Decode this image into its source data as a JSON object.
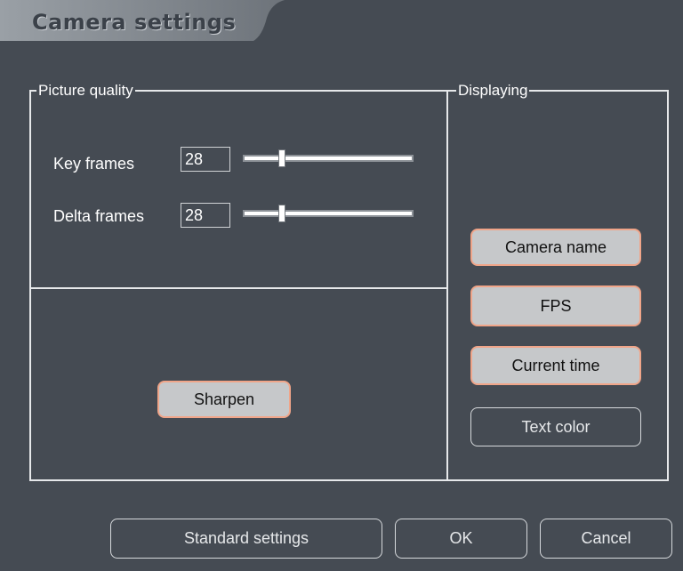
{
  "window": {
    "title": "Camera settings"
  },
  "picture_quality": {
    "legend": "Picture quality",
    "key_frames": {
      "label": "Key frames",
      "value": "28",
      "slider_fraction": 0.22
    },
    "delta_frames": {
      "label": "Delta frames",
      "value": "28",
      "slider_fraction": 0.22
    }
  },
  "sharpen": {
    "label": "Sharpen",
    "active": true
  },
  "displaying": {
    "legend": "Displaying",
    "camera_name": {
      "label": "Camera name",
      "active": true
    },
    "fps": {
      "label": "FPS",
      "active": true
    },
    "current_time": {
      "label": "Current time",
      "active": true
    },
    "text_color": {
      "label": "Text color",
      "active": false
    }
  },
  "footer": {
    "standard_settings": "Standard settings",
    "ok": "OK",
    "cancel": "Cancel"
  },
  "colors": {
    "background": "#454b53",
    "active_button_fill": "#c6c8ca",
    "active_button_border": "#f0a589",
    "frame_line": "#e6e8ea"
  }
}
